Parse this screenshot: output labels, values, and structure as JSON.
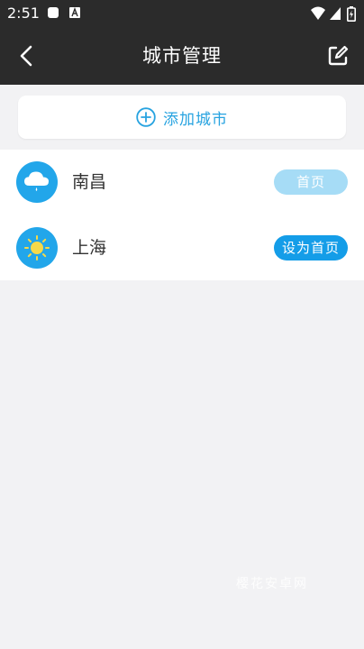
{
  "status_bar": {
    "time": "2:51",
    "left_icons": [
      "app-notification-icon",
      "app-a-icon"
    ],
    "right_icons": [
      "wifi-icon",
      "signal-icon",
      "battery-icon"
    ]
  },
  "app_bar": {
    "title": "城市管理",
    "back_icon": "chevron-left-icon",
    "edit_icon": "edit-icon"
  },
  "add_city": {
    "label": "添加城市",
    "icon": "plus-circle-icon"
  },
  "cities": [
    {
      "name": "南昌",
      "weather_icon": "cloud-rain-icon",
      "button_label": "首页",
      "is_home": true
    },
    {
      "name": "上海",
      "weather_icon": "sun-icon",
      "button_label": "设为首页",
      "is_home": false
    }
  ],
  "watermark": "樱花安卓网",
  "colors": {
    "app_bar": "#2b2b2b",
    "accent": "#27a3e0",
    "avatar_bg": "#22a6ea",
    "home_current": "#a6dcf6",
    "home_action": "#149de8",
    "background": "#f2f2f4",
    "sun": "#f5d94a"
  }
}
